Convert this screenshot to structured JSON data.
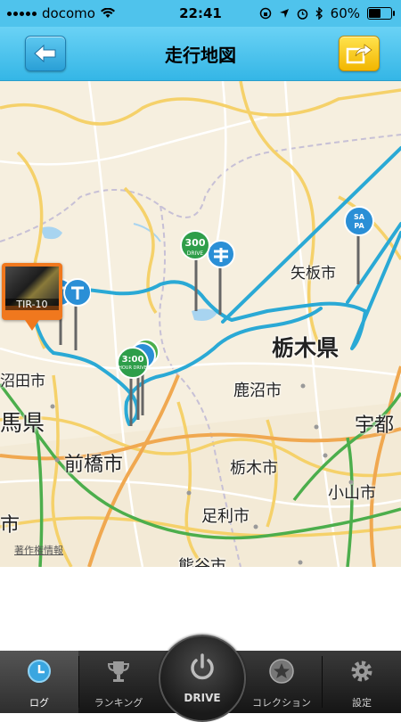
{
  "status_bar": {
    "carrier": "docomo",
    "time": "22:41",
    "battery": "60%",
    "battery_level": 0.6
  },
  "nav": {
    "title": "走行地図",
    "back_icon": "arrow-left-icon",
    "share_icon": "share-icon"
  },
  "map": {
    "places": [
      {
        "id": "yaita",
        "label": "矢板市"
      },
      {
        "id": "tochigi-ken",
        "label": "栃木県"
      },
      {
        "id": "kanuma",
        "label": "鹿沼市"
      },
      {
        "id": "utsunomiya",
        "label": "宇都"
      },
      {
        "id": "maebashi",
        "label": "前橋市"
      },
      {
        "id": "tochigi-shi",
        "label": "栃木市"
      },
      {
        "id": "oyama",
        "label": "小山市"
      },
      {
        "id": "ashikaga",
        "label": "足利市"
      },
      {
        "id": "numata",
        "label": "沼田市"
      },
      {
        "id": "gunma",
        "label": "馬県"
      },
      {
        "id": "kumagaya",
        "label": "熊谷市"
      },
      {
        "id": "ichi",
        "label": "市"
      }
    ],
    "photo_marker_caption": "TIR-10",
    "pins": {
      "drive300": "300",
      "drive300_sub": "DRIVE",
      "hour3": "3:00",
      "hour3_sub": "HOUR DRIVE",
      "sapa_top": "SA",
      "sapa_bottom": "PA"
    },
    "copyright": "著作権情報"
  },
  "tabs": [
    {
      "id": "log",
      "label": "ログ",
      "icon": "clock-icon",
      "active": true
    },
    {
      "id": "ranking",
      "label": "ランキング",
      "icon": "trophy-icon",
      "active": false
    },
    {
      "id": "drive",
      "label": "DRIVE",
      "icon": "power-icon",
      "active": false
    },
    {
      "id": "collection",
      "label": "コレクション",
      "icon": "star-icon",
      "active": false
    },
    {
      "id": "settings",
      "label": "設定",
      "icon": "gear-icon",
      "active": false
    }
  ]
}
